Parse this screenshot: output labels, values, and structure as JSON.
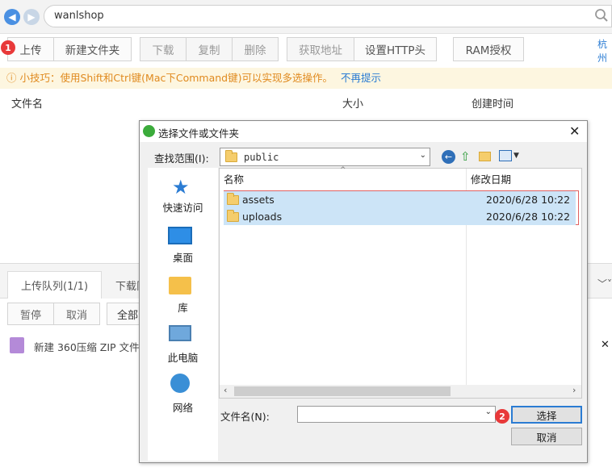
{
  "address": {
    "value": "wanlshop"
  },
  "toolbar": {
    "badge1": "1",
    "upload": "上传",
    "new_folder": "新建文件夹",
    "download": "下载",
    "copy": "复制",
    "delete": "删除",
    "get_address": "获取地址",
    "set_http_header": "设置HTTP头",
    "ram_auth": "RAM授权",
    "region_partial": "杭州"
  },
  "tip": {
    "icon": "info-icon",
    "text": "小技巧：使用Shift和Ctrl键(Mac下Command键)可以实现多选操作。",
    "link": "不再提示"
  },
  "file_table": {
    "col_name": "文件名",
    "col_size": "大小",
    "col_created": "创建时间"
  },
  "queue": {
    "tab_upload": "上传队列(1/1)",
    "tab_download": "下载队",
    "pause": "暂停",
    "cancel": "取消",
    "all": "全部",
    "item_name": "新建 360压缩 ZIP 文件.z"
  },
  "dialog": {
    "title": "选择文件或文件夹",
    "look_in_label": "查找范围(I):",
    "look_in_value": "public",
    "places": [
      "快速访问",
      "桌面",
      "库",
      "此电脑",
      "网络"
    ],
    "col_name": "名称",
    "col_modified": "修改日期",
    "files": [
      {
        "name": "assets",
        "modified": "2020/6/28 10:22"
      },
      {
        "name": "uploads",
        "modified": "2020/6/28 10:22"
      }
    ],
    "filename_label": "文件名(N):",
    "filename_value": "",
    "badge2": "2",
    "select": "选择",
    "cancel": "取消"
  },
  "colors": {
    "accent": "#2b7cd3",
    "badge": "#e8393a",
    "selection": "#cce4f7",
    "tip_text": "#e08a1f"
  }
}
